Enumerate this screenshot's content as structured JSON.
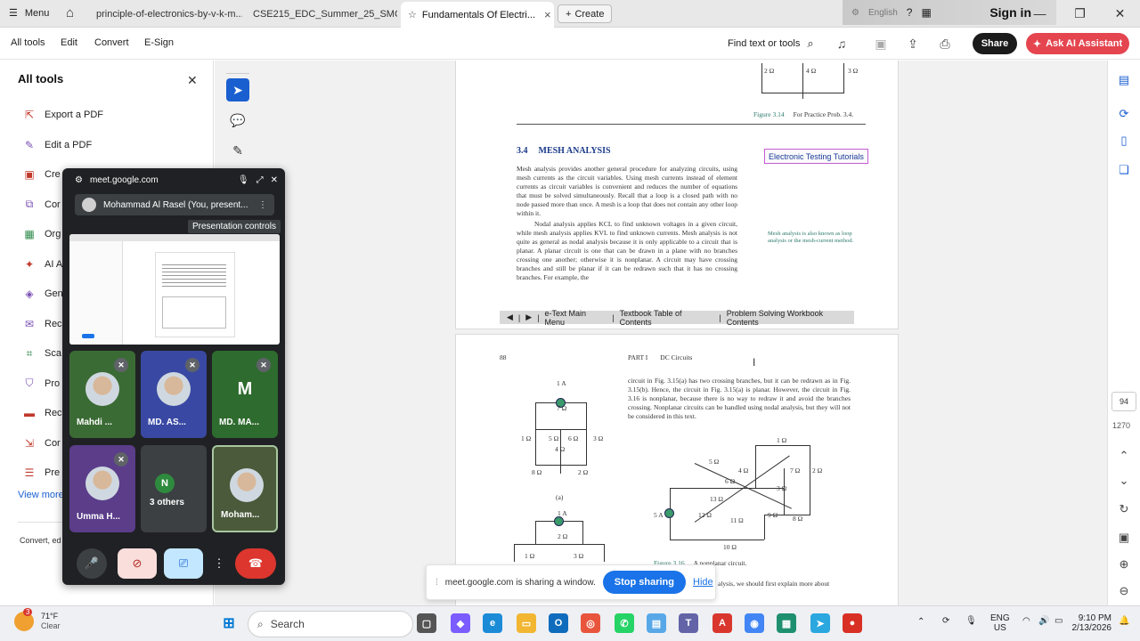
{
  "titlebar": {
    "menu_label": "Menu",
    "tabs": [
      {
        "label": "principle-of-electronics-by-v-k-m..."
      },
      {
        "label": "CSE215_EDC_Summer_25_SMC(..."
      },
      {
        "label": "Fundamentals Of Electri..."
      }
    ],
    "new_tab_label": "Create",
    "overlay_text": "English",
    "sign_in": "Sign in"
  },
  "toolbar": {
    "menus": [
      "All tools",
      "Edit",
      "Convert",
      "E-Sign"
    ],
    "find_label": "Find text or tools",
    "share_label": "Share",
    "ai_label": "Ask AI Assistant"
  },
  "left_panel": {
    "title": "All tools",
    "items": [
      {
        "label": "Export a PDF",
        "icon": "export-pdf-icon"
      },
      {
        "label": "Edit a PDF",
        "icon": "edit-pdf-icon"
      },
      {
        "label": "Cre",
        "icon": "create-pdf-icon"
      },
      {
        "label": "Cor",
        "icon": "combine-icon"
      },
      {
        "label": "Org",
        "icon": "organize-icon"
      },
      {
        "label": "AI A",
        "icon": "ai-icon"
      },
      {
        "label": "Gen",
        "icon": "generate-icon"
      },
      {
        "label": "Rec",
        "icon": "request-icon"
      },
      {
        "label": "Sca",
        "icon": "scan-icon"
      },
      {
        "label": "Pro",
        "icon": "protect-icon"
      },
      {
        "label": "Rec",
        "icon": "redact-icon"
      },
      {
        "label": "Cor",
        "icon": "compress-icon"
      },
      {
        "label": "Pre",
        "icon": "prepare-icon"
      }
    ],
    "view_more": "View more",
    "footer": "Convert, ed"
  },
  "document": {
    "page1": {
      "resistors_top": [
        "2 Ω",
        "4 Ω",
        "3 Ω"
      ],
      "figure_caption": "Figure 3.14",
      "figure_caption_text": "For Practice Prob. 3.4.",
      "section_number": "3.4",
      "section_title": "MESH ANALYSIS",
      "tutorial_link": "Electronic Testing Tutorials",
      "para1": "Mesh analysis provides another general procedure for analyzing circuits, using mesh currents as the circuit variables. Using mesh currents instead of element currents as circuit variables is convenient and reduces the number of equations that must be solved simultaneously. Recall that a loop is a closed path with no node passed more than once. A mesh is a loop that does not contain any other loop within it.",
      "para2": "Nodal analysis applies KCL to find unknown voltages in a given circuit, while mesh analysis applies KVL to find unknown currents. Mesh analysis is not quite as general as nodal analysis because it is only applicable to a circuit that is planar. A planar circuit is one that can be drawn in a plane with no branches crossing one another; otherwise it is nonplanar. A circuit may have crossing branches and still be planar if it can be redrawn such that it has no crossing branches. For example, the",
      "side_note": "Mesh analysis is also known as loop analysis or the mesh-current method.",
      "nav_links": [
        "e-Text Main Menu",
        "Textbook Table of Contents",
        "Problem Solving Workbook Contents"
      ]
    },
    "page2": {
      "page_number": "88",
      "part": "PART I",
      "part_title": "DC Circuits",
      "para": "circuit in Fig. 3.15(a) has two crossing branches, but it can be redrawn as in Fig. 3.15(b). Hence, the circuit in Fig. 3.15(a) is planar. However, the circuit in Fig. 3.16 is nonplanar, because there is no way to redraw it and avoid the branches crossing. Nonplanar circuits can be handled using nodal analysis, but they will not be considered in this text.",
      "fig_a_labels": [
        "1 A",
        "7 Ω",
        "1 Ω",
        "5 Ω",
        "6 Ω",
        "3 Ω",
        "4 Ω",
        "8 Ω",
        "2 Ω",
        "(a)"
      ],
      "fig_b_labels": [
        "1 A",
        "2 Ω",
        "1 Ω",
        "3 Ω"
      ],
      "fig16_labels": [
        "1 Ω",
        "5 Ω",
        "4 Ω",
        "6 Ω",
        "2 Ω",
        "7 Ω",
        "13 Ω",
        "3 Ω",
        "5 A",
        "12 Ω",
        "11 Ω",
        "9 Ω",
        "8 Ω",
        "10 Ω"
      ],
      "fig16_caption": "Figure 3.16",
      "fig16_caption_text": "A nonplanar circuit.",
      "tail_text": "alysis, we should first explain more about"
    }
  },
  "right_bar": {
    "page_current": "94",
    "page_total": "1270"
  },
  "meet": {
    "url": "meet.google.com",
    "presenter": "Mohammad Al Rasel (You, present...",
    "tooltip": "Presentation controls",
    "tiles": [
      {
        "name": "Mahdi ...",
        "color": "#3b6b35"
      },
      {
        "name": "MD. AS...",
        "color": "#3949a3"
      },
      {
        "name": "MD. MA...",
        "color": "#2e6b2e",
        "initial": "M"
      },
      {
        "name": "Umma H...",
        "color": "#5b3d8a"
      },
      {
        "name": "3 others",
        "color": "#3c4043",
        "initial": "N"
      },
      {
        "name": "Moham...",
        "color": "#4a5a3a"
      }
    ]
  },
  "share_bar": {
    "text": "meet.google.com is sharing a window.",
    "stop": "Stop sharing",
    "hide": "Hide"
  },
  "taskbar": {
    "temp": "71°F",
    "condition": "Clear",
    "badge": "3",
    "search": "Search",
    "lang1": "ENG",
    "lang2": "US",
    "time": "9:10 PM",
    "date": "2/13/2026"
  }
}
